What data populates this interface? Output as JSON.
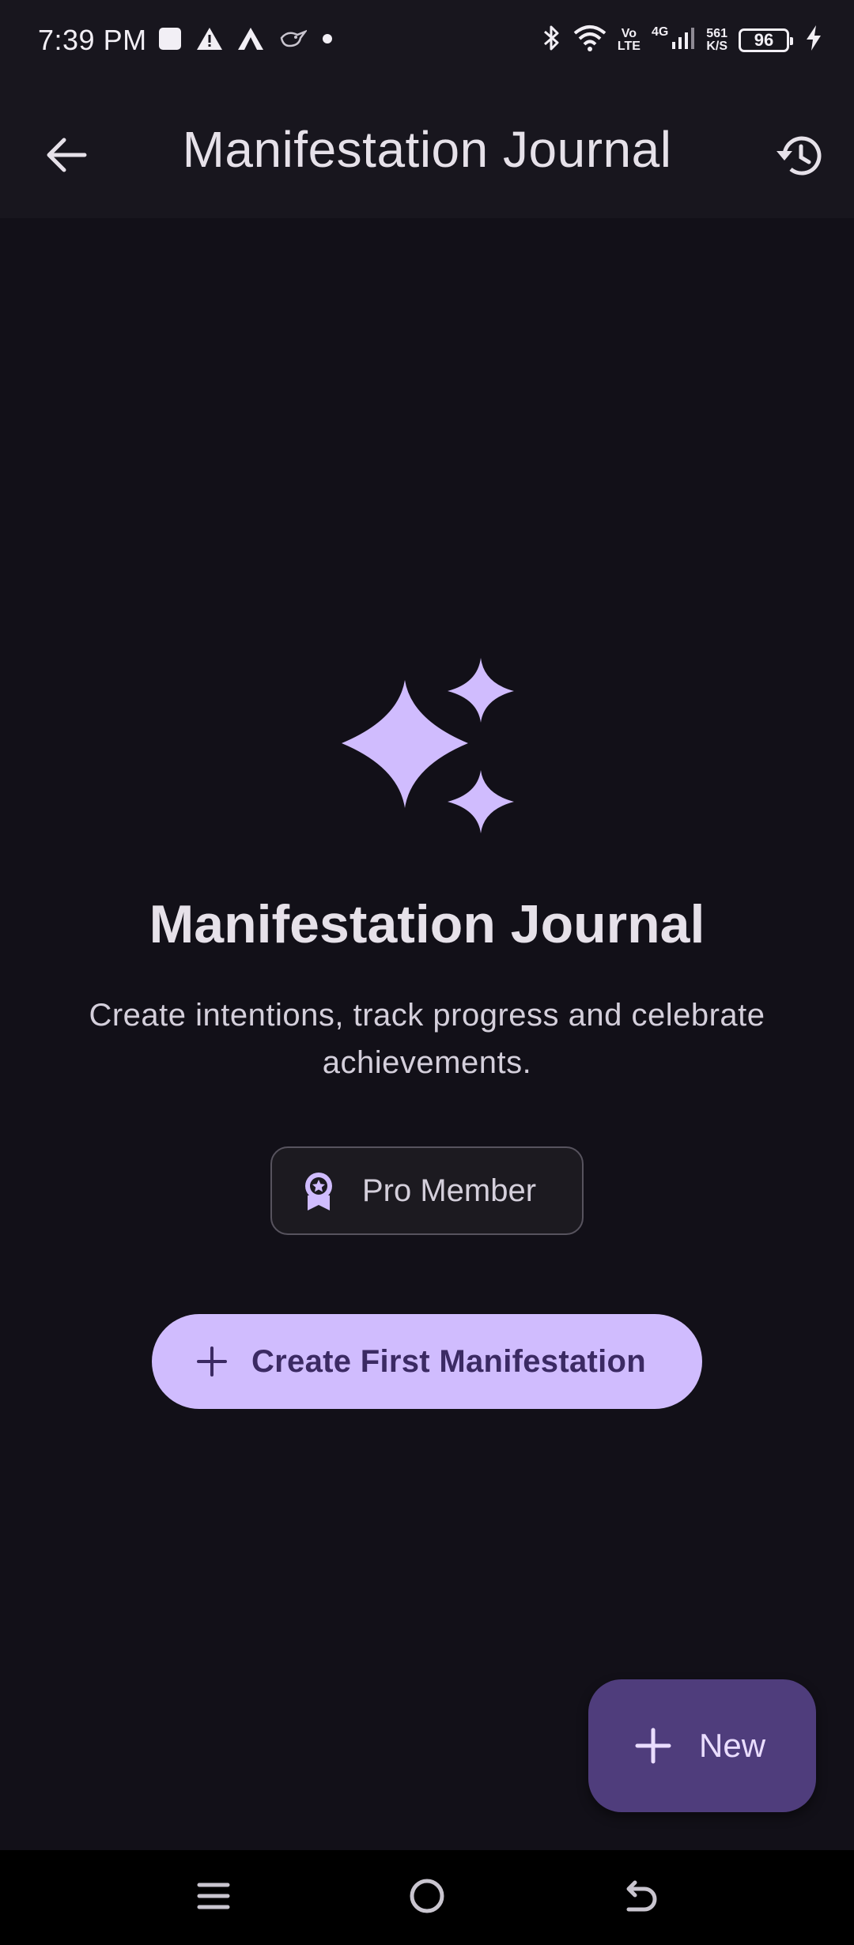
{
  "status_bar": {
    "time": "7:39 PM",
    "network_top": "Vo",
    "network_bottom": "LTE",
    "cell_type": "4G",
    "speed_value": "561",
    "speed_unit": "K/S",
    "battery_level": "96",
    "icons": [
      "square-notification-icon",
      "warning-icon",
      "app-a-icon",
      "bird-icon",
      "dot-icon",
      "bluetooth-icon",
      "wifi-icon",
      "signal-icon",
      "battery-icon",
      "charging-icon"
    ]
  },
  "app_bar": {
    "title": "Manifestation Journal",
    "back_icon": "arrow-back-icon",
    "history_icon": "history-icon"
  },
  "empty_state": {
    "icon": "sparkles-icon",
    "title": "Manifestation Journal",
    "subtitle": "Create intentions, track progress and celebrate achievements.",
    "chip_label": "Pro Member",
    "chip_icon": "award-icon",
    "cta_label": "Create First Manifestation",
    "cta_icon": "plus-icon"
  },
  "fab": {
    "label": "New",
    "icon": "plus-icon"
  },
  "nav_bar": {
    "icons": [
      "menu-icon",
      "home-icon",
      "back-nav-icon"
    ]
  },
  "colors": {
    "background": "#121018",
    "accent": "#d0bcfe",
    "fab_background": "#4f3d7c",
    "on_accent": "#3b2a63"
  }
}
